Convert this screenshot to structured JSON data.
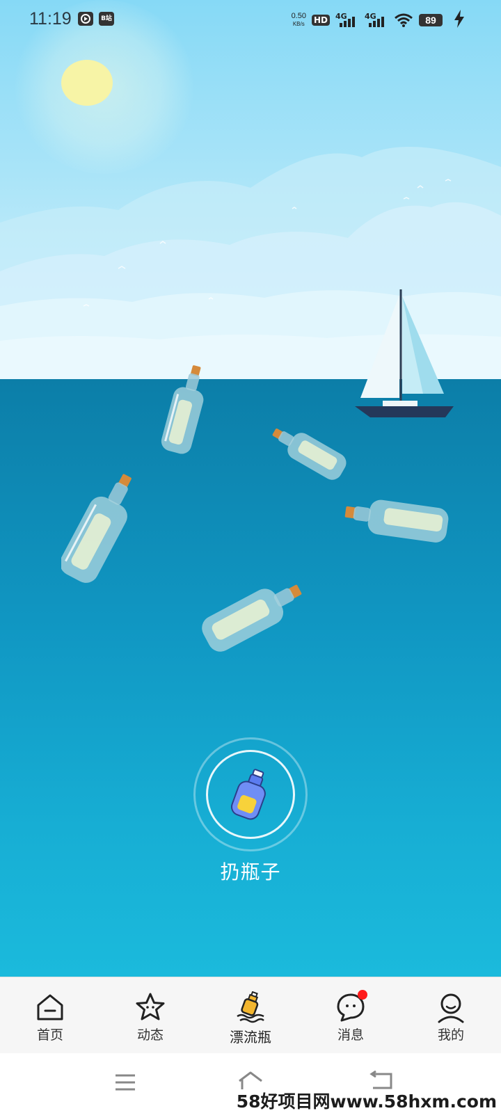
{
  "status_bar": {
    "time": "11:19",
    "net_speed_value": "0.50",
    "net_speed_unit": "KB/s",
    "hd_label": "HD",
    "sim1_label": "4G",
    "sim2_label": "4G",
    "battery_level": "89",
    "app_icons": [
      "video-app-icon",
      "tv-app-icon"
    ],
    "tv_icon_text": "B站"
  },
  "main": {
    "throw_button_label": "扔瓶子",
    "floating_bottles": 5
  },
  "bottom_nav": {
    "items": [
      {
        "label": "首页",
        "icon": "home-icon"
      },
      {
        "label": "动态",
        "icon": "star-icon"
      },
      {
        "label": "漂流瓶",
        "icon": "drift-bottle-icon",
        "active": true
      },
      {
        "label": "消息",
        "icon": "message-icon",
        "badge": true
      },
      {
        "label": "我的",
        "icon": "profile-icon"
      }
    ]
  },
  "watermark": "58好项目网www.58hxm.com",
  "colors": {
    "sky_top": "#86d9f6",
    "sea_top": "#0c7ea8",
    "sea_bottom": "#1bbadc",
    "nav_bg": "#f6f6f6",
    "badge": "#ff1a1a"
  }
}
